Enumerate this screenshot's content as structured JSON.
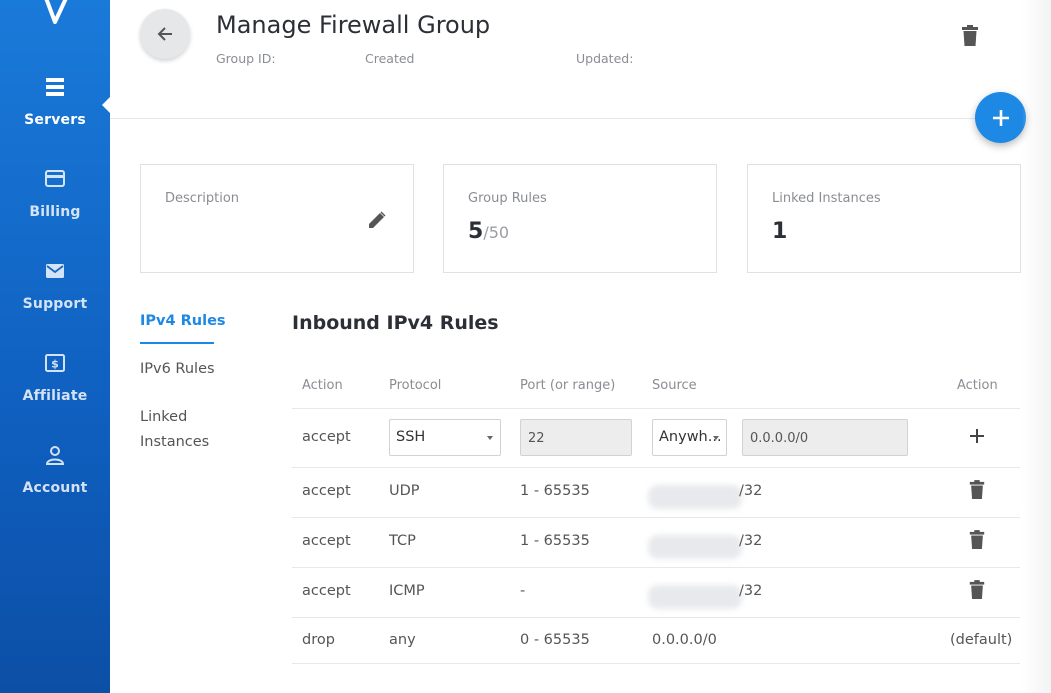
{
  "sidebar": {
    "items": [
      {
        "label": "Servers",
        "icon": "servers-icon",
        "active": true
      },
      {
        "label": "Billing",
        "icon": "credit-card-icon"
      },
      {
        "label": "Support",
        "icon": "mail-icon"
      },
      {
        "label": "Affiliate",
        "icon": "dollar-icon"
      },
      {
        "label": "Account",
        "icon": "person-icon"
      }
    ]
  },
  "header": {
    "title": "Manage Firewall Group",
    "group_id_label": "Group ID:",
    "created_label": "Created",
    "updated_label": "Updated:"
  },
  "cards": {
    "description": {
      "label": "Description"
    },
    "group_rules": {
      "label": "Group Rules",
      "value": "5",
      "suffix": "/50"
    },
    "linked_instances": {
      "label": "Linked Instances",
      "value": "1"
    }
  },
  "side_tabs": {
    "ipv4": "IPv4 Rules",
    "ipv6": "IPv6 Rules",
    "linked_line1": "Linked",
    "linked_line2": "Instances"
  },
  "table": {
    "title": "Inbound IPv4 Rules",
    "headers": {
      "action": "Action",
      "protocol": "Protocol",
      "port": "Port (or range)",
      "source": "Source",
      "row_action": "Action"
    },
    "new_rule": {
      "action": "accept",
      "protocol": "SSH",
      "port": "22",
      "source_select": "Anywh...",
      "source_value": "0.0.0.0/0"
    },
    "rows": [
      {
        "action": "accept",
        "protocol": "UDP",
        "port": "1 - 65535",
        "source": "/32"
      },
      {
        "action": "accept",
        "protocol": "TCP",
        "port": "1 - 65535",
        "source": "/32"
      },
      {
        "action": "accept",
        "protocol": "ICMP",
        "port": "-",
        "source": "/32"
      },
      {
        "action": "drop",
        "protocol": "any",
        "port": "0 - 65535",
        "source": "0.0.0.0/0",
        "row_action": "(default)"
      }
    ]
  },
  "colors": {
    "accent": "#1e88e5",
    "sidebar": "#0f5fbf"
  }
}
